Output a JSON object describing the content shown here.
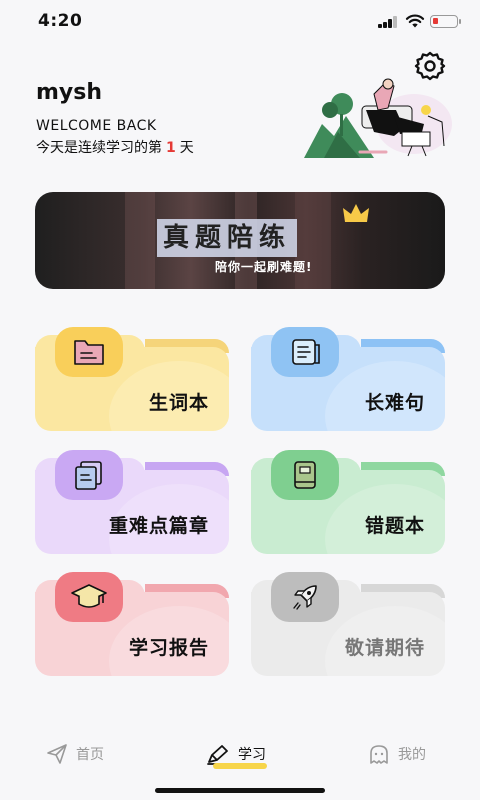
{
  "status_bar": {
    "time": "4:20"
  },
  "header": {
    "username": "mysh",
    "welcome": "WELCOME BACK",
    "streak_prefix": "今天是连续学习的第",
    "streak_count": "1",
    "streak_suffix": "天"
  },
  "banner": {
    "title": "真题陪练",
    "subtitle": "陪你一起刷难题!"
  },
  "cards": [
    {
      "label": "生词本",
      "icon": "folder-doc-icon",
      "color": "#fbe7a1"
    },
    {
      "label": "长难句",
      "icon": "scroll-icon",
      "color": "#c6e0fb"
    },
    {
      "label": "重难点篇章",
      "icon": "documents-icon",
      "color": "#ead9fa"
    },
    {
      "label": "错题本",
      "icon": "notebook-icon",
      "color": "#c9ecd1"
    },
    {
      "label": "学习报告",
      "icon": "graduation-cap-icon",
      "color": "#f8d3d6"
    },
    {
      "label": "敬请期待",
      "icon": "rocket-icon",
      "color": "#ebebeb"
    }
  ],
  "tabbar": {
    "tabs": [
      {
        "label": "首页",
        "icon": "paper-plane-icon",
        "active": false
      },
      {
        "label": "学习",
        "icon": "pen-icon",
        "active": true
      },
      {
        "label": "我的",
        "icon": "ghost-icon",
        "active": false
      }
    ]
  }
}
